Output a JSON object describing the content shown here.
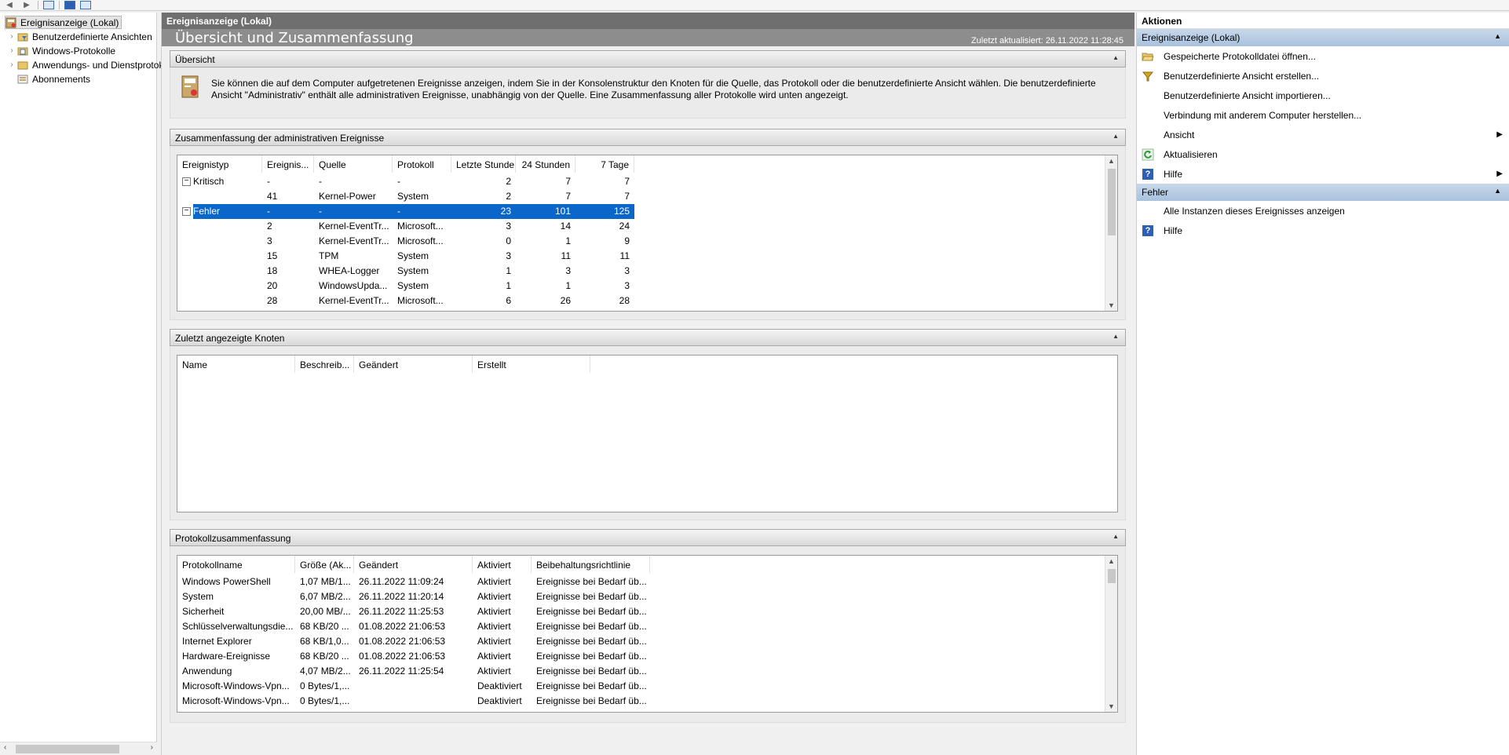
{
  "toolbar": {
    "icons": [
      "back-arrow-icon",
      "forward-arrow-icon",
      "console-tree-icon",
      "help-icon",
      "action-pane-icon"
    ]
  },
  "tree": {
    "root": "Ereignisanzeige (Lokal)",
    "items": [
      {
        "label": "Benutzerdefinierte Ansichten",
        "icon": "folder-filter-icon"
      },
      {
        "label": "Windows-Protokolle",
        "icon": "folder-log-icon"
      },
      {
        "label": "Anwendungs- und Dienstprotokolle",
        "icon": "folder-icon"
      },
      {
        "label": "Abonnements",
        "icon": "subscription-icon"
      }
    ]
  },
  "center": {
    "header": "Ereignisanzeige (Lokal)",
    "title": "Übersicht und Zusammenfassung",
    "updated": "Zuletzt aktualisiert: 26.11.2022 11:28:45",
    "overview": {
      "heading": "Übersicht",
      "line1": "Sie können die auf dem Computer aufgetretenen Ereignisse anzeigen, indem Sie in der Konsolenstruktur den Knoten für die Quelle, das Protokoll oder die benutzerdefinierte Ansicht wählen. Die benutzerdefinierte",
      "line2": "Ansicht \"Administrativ\" enthält alle administrativen Ereignisse, unabhängig von der Quelle. Eine Zusammenfassung aller Protokolle wird unten angezeigt."
    },
    "admin_summary": {
      "heading": "Zusammenfassung der administrativen Ereignisse",
      "columns": [
        "Ereignistyp",
        "Ereignis...",
        "Quelle",
        "Protokoll",
        "Letzte Stunde",
        "24 Stunden",
        "7 Tage"
      ],
      "rows": [
        {
          "type": "Kritisch",
          "id": "-",
          "source": "-",
          "log": "-",
          "h1": "2",
          "h24": "7",
          "d7": "7",
          "group": true
        },
        {
          "type": "",
          "id": "41",
          "source": "Kernel-Power",
          "log": "System",
          "h1": "2",
          "h24": "7",
          "d7": "7"
        },
        {
          "type": "Fehler",
          "id": "-",
          "source": "-",
          "log": "-",
          "h1": "23",
          "h24": "101",
          "d7": "125",
          "group": true,
          "selected": true
        },
        {
          "type": "",
          "id": "2",
          "source": "Kernel-EventTr...",
          "log": "Microsoft...",
          "h1": "3",
          "h24": "14",
          "d7": "24"
        },
        {
          "type": "",
          "id": "3",
          "source": "Kernel-EventTr...",
          "log": "Microsoft...",
          "h1": "0",
          "h24": "1",
          "d7": "9"
        },
        {
          "type": "",
          "id": "15",
          "source": "TPM",
          "log": "System",
          "h1": "3",
          "h24": "11",
          "d7": "11"
        },
        {
          "type": "",
          "id": "18",
          "source": "WHEA-Logger",
          "log": "System",
          "h1": "1",
          "h24": "3",
          "d7": "3"
        },
        {
          "type": "",
          "id": "20",
          "source": "WindowsUpda...",
          "log": "System",
          "h1": "1",
          "h24": "1",
          "d7": "3"
        },
        {
          "type": "",
          "id": "28",
          "source": "Kernel-EventTr...",
          "log": "Microsoft...",
          "h1": "6",
          "h24": "26",
          "d7": "28"
        }
      ]
    },
    "recent_nodes": {
      "heading": "Zuletzt angezeigte Knoten",
      "columns": [
        "Name",
        "Beschreib...",
        "Geändert",
        "Erstellt"
      ]
    },
    "log_summary": {
      "heading": "Protokollzusammenfassung",
      "columns": [
        "Protokollname",
        "Größe (Ak...",
        "Geändert",
        "Aktiviert",
        "Beibehaltungsrichtlinie"
      ],
      "rows": [
        [
          "Windows PowerShell",
          "1,07 MB/1...",
          "26.11.2022 11:09:24",
          "Aktiviert",
          "Ereignisse bei Bedarf üb..."
        ],
        [
          "System",
          "6,07 MB/2...",
          "26.11.2022 11:20:14",
          "Aktiviert",
          "Ereignisse bei Bedarf üb..."
        ],
        [
          "Sicherheit",
          "20,00 MB/...",
          "26.11.2022 11:25:53",
          "Aktiviert",
          "Ereignisse bei Bedarf üb..."
        ],
        [
          "Schlüsselverwaltungsdie...",
          "68 KB/20 ...",
          "01.08.2022 21:06:53",
          "Aktiviert",
          "Ereignisse bei Bedarf üb..."
        ],
        [
          "Internet Explorer",
          "68 KB/1,0...",
          "01.08.2022 21:06:53",
          "Aktiviert",
          "Ereignisse bei Bedarf üb..."
        ],
        [
          "Hardware-Ereignisse",
          "68 KB/20 ...",
          "01.08.2022 21:06:53",
          "Aktiviert",
          "Ereignisse bei Bedarf üb..."
        ],
        [
          "Anwendung",
          "4,07 MB/2...",
          "26.11.2022 11:25:54",
          "Aktiviert",
          "Ereignisse bei Bedarf üb..."
        ],
        [
          "Microsoft-Windows-Vpn...",
          "0 Bytes/1,...",
          "",
          "Deaktiviert",
          "Ereignisse bei Bedarf üb..."
        ],
        [
          "Microsoft-Windows-Vpn...",
          "0 Bytes/1,...",
          "",
          "Deaktiviert",
          "Ereignisse bei Bedarf üb..."
        ]
      ]
    }
  },
  "actions": {
    "header": "Aktionen",
    "section1": {
      "title": "Ereignisanzeige (Lokal)",
      "items": [
        {
          "label": "Gespeicherte Protokolldatei öffnen...",
          "icon": "open-folder-icon"
        },
        {
          "label": "Benutzerdefinierte Ansicht erstellen...",
          "icon": "filter-icon"
        },
        {
          "label": "Benutzerdefinierte Ansicht importieren...",
          "icon": ""
        },
        {
          "label": "Verbindung mit anderem Computer herstellen...",
          "icon": ""
        },
        {
          "label": "Ansicht",
          "icon": "",
          "submenu": true
        },
        {
          "label": "Aktualisieren",
          "icon": "refresh-icon"
        },
        {
          "label": "Hilfe",
          "icon": "help-icon",
          "submenu": true
        }
      ]
    },
    "section2": {
      "title": "Fehler",
      "items": [
        {
          "label": "Alle Instanzen dieses Ereignisses anzeigen",
          "icon": ""
        },
        {
          "label": "Hilfe",
          "icon": "help-icon"
        }
      ]
    }
  }
}
